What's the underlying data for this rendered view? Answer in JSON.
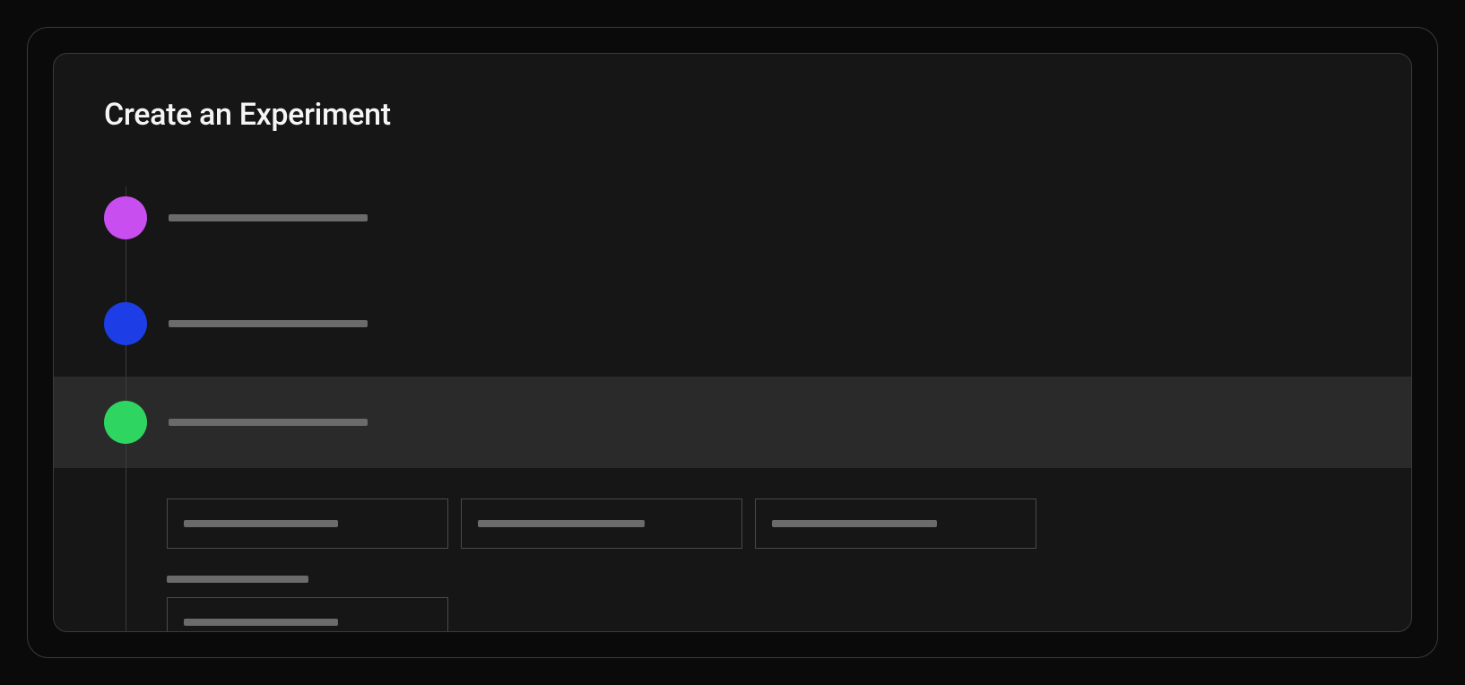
{
  "page": {
    "title": "Create an Experiment"
  },
  "steps": [
    {
      "id": "step-1",
      "color": "purple",
      "active": false
    },
    {
      "id": "step-2",
      "color": "blue",
      "active": false
    },
    {
      "id": "step-3",
      "color": "green",
      "active": true
    }
  ],
  "colors": {
    "purple": "#c84ef0",
    "blue": "#1d3ee6",
    "green": "#2ed661",
    "background": "#161616",
    "activeBackground": "#2a2a2a",
    "border": "#3a3a3a"
  }
}
